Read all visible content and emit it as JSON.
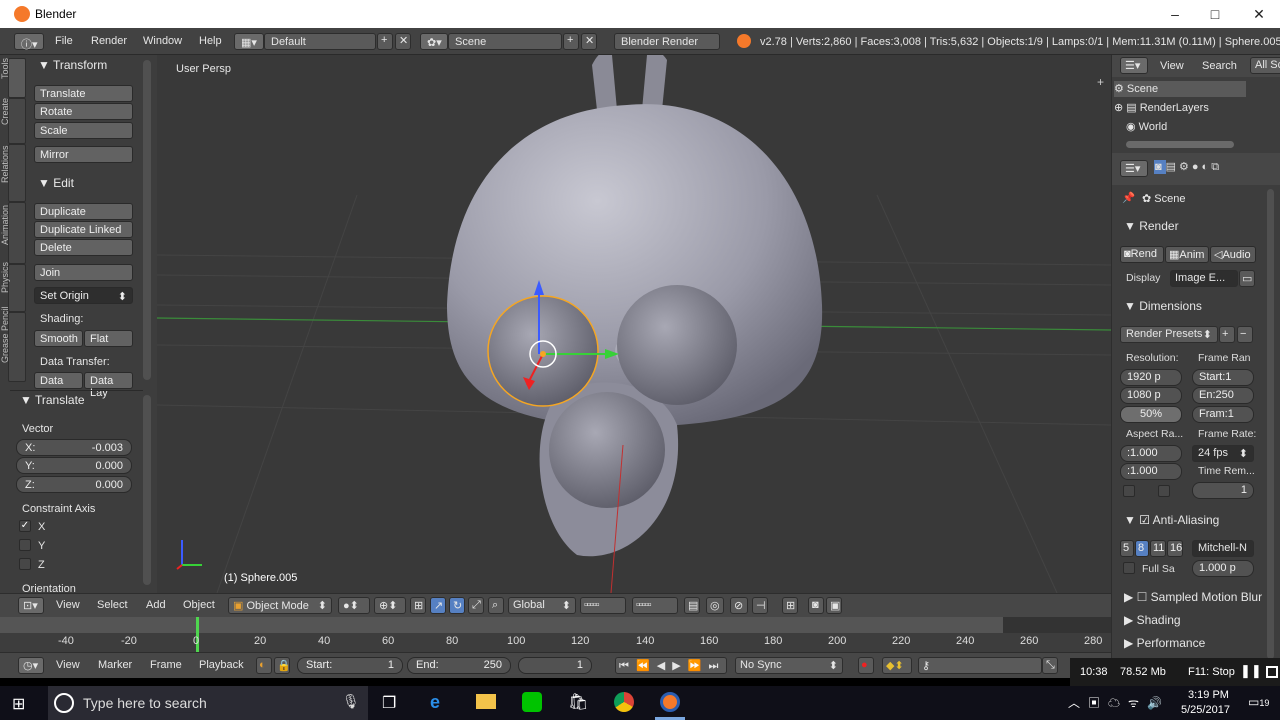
{
  "window": {
    "title": "Blender",
    "minimize": "–",
    "maximize": "□",
    "close": "✕"
  },
  "topbar": {
    "menus": [
      "File",
      "Render",
      "Window",
      "Help"
    ],
    "layout": "Default",
    "scene": "Scene",
    "engine": "Blender Render",
    "stats": "v2.78 | Verts:2,860 | Faces:3,008 | Tris:5,632 | Objects:1/9 | Lamps:0/1 | Mem:11.31M (0.11M) | Sphere.005"
  },
  "tool_tabs": [
    "Tools",
    "Create",
    "Relations",
    "Animation",
    "Physics",
    "Grease Pencil"
  ],
  "toolshelf": {
    "transform_header": "Transform",
    "translate": "Translate",
    "rotate": "Rotate",
    "scale": "Scale",
    "mirror": "Mirror",
    "edit_header": "Edit",
    "duplicate": "Duplicate",
    "duplicate_linked": "Duplicate Linked",
    "delete": "Delete",
    "join": "Join",
    "set_origin": "Set Origin",
    "shading_label": "Shading:",
    "smooth": "Smooth",
    "flat": "Flat",
    "data_transfer_label": "Data Transfer:",
    "data": "Data",
    "data_layout": "Data Lay"
  },
  "operator": {
    "header": "Translate",
    "vector_label": "Vector",
    "x": "X:",
    "x_val": "-0.003",
    "y": "Y:",
    "y_val": "0.000",
    "z": "Z:",
    "z_val": "0.000",
    "constraint_label": "Constraint Axis",
    "cx": "X",
    "cy": "Y",
    "cz": "Z",
    "orientation": "Orientation"
  },
  "viewport": {
    "view_name": "User Persp",
    "object_label": "(1) Sphere.005"
  },
  "viewport_header": {
    "view": "View",
    "select": "Select",
    "add": "Add",
    "object": "Object",
    "mode": "Object Mode",
    "orientation": "Global"
  },
  "timeline": {
    "ticks": [
      "-40",
      "-20",
      "0",
      "20",
      "40",
      "60",
      "80",
      "100",
      "120",
      "140",
      "160",
      "180",
      "200",
      "220",
      "240",
      "260",
      "280"
    ],
    "current_frame": 1
  },
  "timeline_header": {
    "view": "View",
    "marker": "Marker",
    "frame": "Frame",
    "playback": "Playback",
    "start_label": "Start:",
    "start": "1",
    "end_label": "End:",
    "end": "250",
    "current": "1",
    "sync": "No Sync"
  },
  "outliner": {
    "view": "View",
    "search": "Search",
    "all_scenes": "All Sc",
    "items": [
      "Scene",
      "RenderLayers",
      "World"
    ]
  },
  "properties": {
    "context": "Scene",
    "render_header": "Render",
    "render_btn": "Rend",
    "anim_btn": "Anim",
    "audio_btn": "Audio",
    "display_label": "Display",
    "display_value": "Image E...",
    "dimensions_header": "Dimensions",
    "presets": "Render Presets",
    "resolution_label": "Resolution:",
    "res_x": "1920 p",
    "res_y": "1080 p",
    "res_pct": "50%",
    "frame_range_label": "Frame Ran",
    "start": "Start:1",
    "end": "En:250",
    "step": "Fram:1",
    "aspect_label": "Aspect Ra...",
    "aspect_x": ":1.000",
    "aspect_y": ":1.000",
    "frame_rate_label": "Frame Rate:",
    "fps": "24 fps",
    "time_remap": "Time Rem...",
    "remap_val": "1",
    "aa_header": "Anti-Aliasing",
    "aa_samples": [
      "5",
      "8",
      "11",
      "16"
    ],
    "aa_filter": "Mitchell-N",
    "full_sample": "Full Sa",
    "filter_size": "1.000 p",
    "sampled_motion": "Sampled Motion Blur",
    "shading": "Shading",
    "performance": "Performance"
  },
  "infobar": {
    "time": "10:38",
    "mem": "78.52 Mb",
    "hint": "F11: Stop"
  },
  "taskbar": {
    "search_placeholder": "Type here to search",
    "clock_time": "3:19 PM",
    "clock_date": "5/25/2017",
    "notif_count": "19"
  },
  "colors": {
    "accent_blue": "#5680c2",
    "selection_orange": "#f5a623",
    "blender_orange": "#f5792a",
    "grid_green": "#3a8c3a"
  }
}
